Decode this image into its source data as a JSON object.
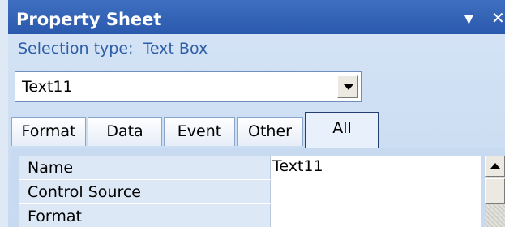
{
  "window": {
    "title": "Property Sheet",
    "dropdown_glyph": "▼",
    "close_glyph": "✕"
  },
  "selection": {
    "label": "Selection type:",
    "value": "Text Box"
  },
  "object_selector": {
    "value": "Text11"
  },
  "tabs": [
    {
      "label": "Format",
      "selected": false
    },
    {
      "label": "Data",
      "selected": false
    },
    {
      "label": "Event",
      "selected": false
    },
    {
      "label": "Other",
      "selected": false
    },
    {
      "label": "All",
      "selected": true
    }
  ],
  "properties": [
    {
      "name": "Name",
      "value": "Text11"
    },
    {
      "name": "Control Source",
      "value": ""
    },
    {
      "name": "Format",
      "value": ""
    }
  ],
  "icons": {
    "combo_arrow": "chevron-down-icon",
    "scroll_up": "chevron-up-icon"
  }
}
